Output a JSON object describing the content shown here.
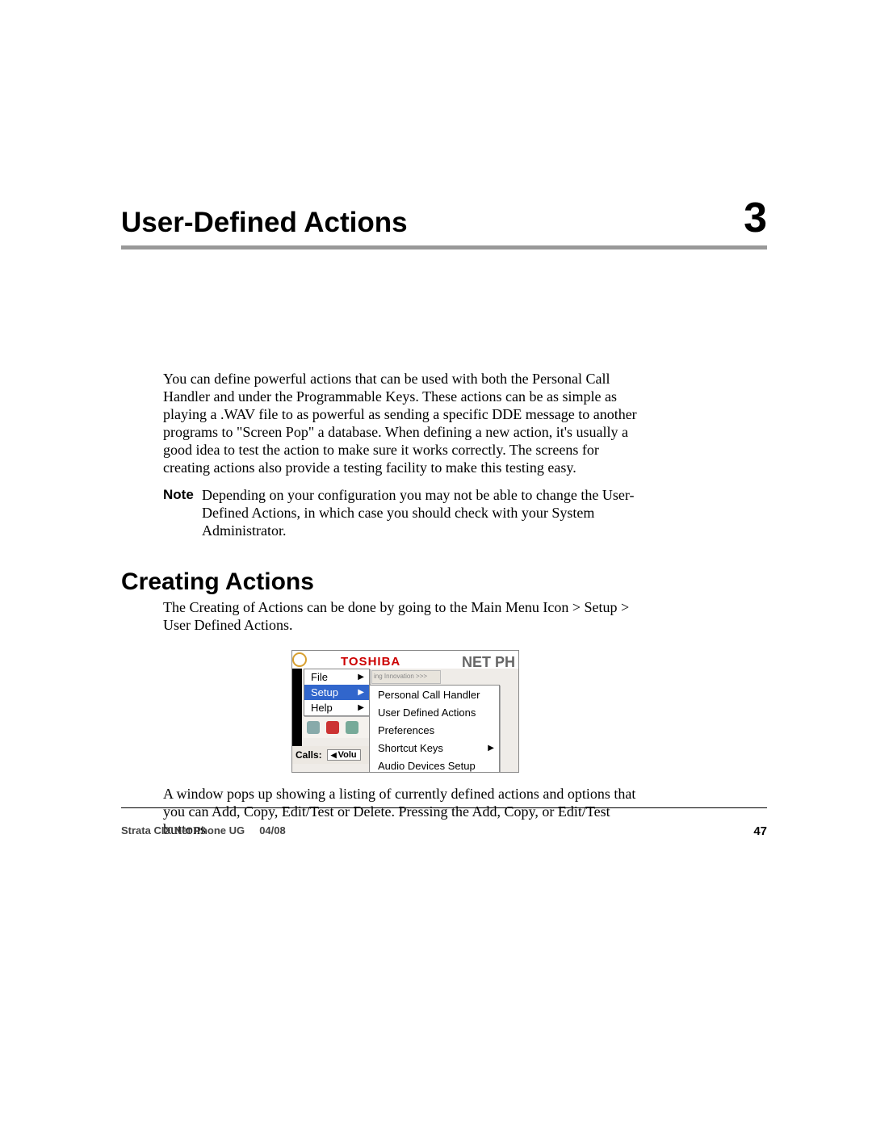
{
  "chapter": {
    "title": "User-Defined Actions",
    "number": "3"
  },
  "paragraphs": {
    "intro": "You can define powerful actions that can be used with both the Personal Call Handler and under the Programmable Keys.  These actions can be as simple as playing a .WAV file to as powerful as sending a specific DDE message to another programs to \"Screen Pop\" a database.   When defining a new action, it's usually a good idea to test the action to make sure it works correctly.   The screens for creating actions also provide a testing facility to make this testing easy.",
    "note_label": "Note",
    "note_text": "Depending on your configuration you may not be able to change the User-Defined Actions, in which case you should check with your System Administrator.",
    "section_title": "Creating Actions",
    "creating_intro": "The Creating of Actions can be done by going to the Main Menu Icon > Setup > User Defined Actions.",
    "after_image": "A window pops up showing a listing of currently defined actions and options that you can Add, Copy, Edit/Test or Delete.  Pressing the Add, Copy, or Edit/Test buttons"
  },
  "screenshot": {
    "brand": "TOSHIBA",
    "tagline": "ing Innovation >>>",
    "product": "NET PH",
    "menu": {
      "file": "File",
      "setup": "Setup",
      "help": "Help"
    },
    "submenu": {
      "pch": "Personal Call Handler",
      "uda": "User Defined Actions",
      "prefs": "Preferences",
      "shortcut": "Shortcut Keys",
      "audio": "Audio Devices Setup"
    },
    "calls_label": "Calls:",
    "volu": "Volu"
  },
  "footer": {
    "left_doc": "Strata CIX Net Phone UG",
    "left_date": "04/08",
    "page": "47"
  }
}
